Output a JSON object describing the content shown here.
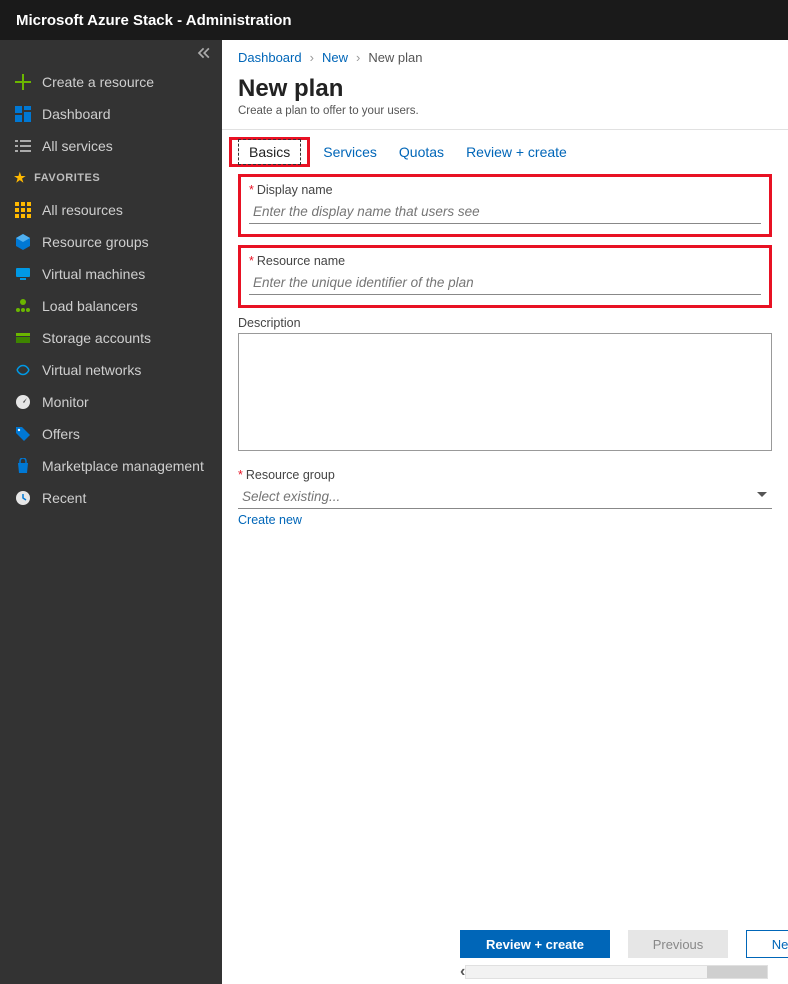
{
  "topbar": {
    "title": "Microsoft Azure Stack - Administration"
  },
  "sidebar": {
    "create": "Create a resource",
    "dashboard": "Dashboard",
    "allservices": "All services",
    "favorites_header": "FAVORITES",
    "items": [
      {
        "label": "All resources"
      },
      {
        "label": "Resource groups"
      },
      {
        "label": "Virtual machines"
      },
      {
        "label": "Load balancers"
      },
      {
        "label": "Storage accounts"
      },
      {
        "label": "Virtual networks"
      },
      {
        "label": "Monitor"
      },
      {
        "label": "Offers"
      },
      {
        "label": "Marketplace management"
      },
      {
        "label": "Recent"
      }
    ]
  },
  "breadcrumb": {
    "dashboard": "Dashboard",
    "new": "New",
    "current": "New plan"
  },
  "page": {
    "title": "New plan",
    "subtitle": "Create a plan to offer to your users."
  },
  "tabs": {
    "basics": "Basics",
    "services": "Services",
    "quotas": "Quotas",
    "review": "Review + create"
  },
  "fields": {
    "display_name_label": "Display name",
    "display_name_placeholder": "Enter the display name that users see",
    "resource_name_label": "Resource name",
    "resource_name_placeholder": "Enter the unique identifier of the plan",
    "description_label": "Description",
    "resource_group_label": "Resource group",
    "resource_group_placeholder": "Select existing...",
    "create_new": "Create new"
  },
  "footer": {
    "review": "Review + create",
    "previous": "Previous",
    "next": "Next : Services >"
  }
}
